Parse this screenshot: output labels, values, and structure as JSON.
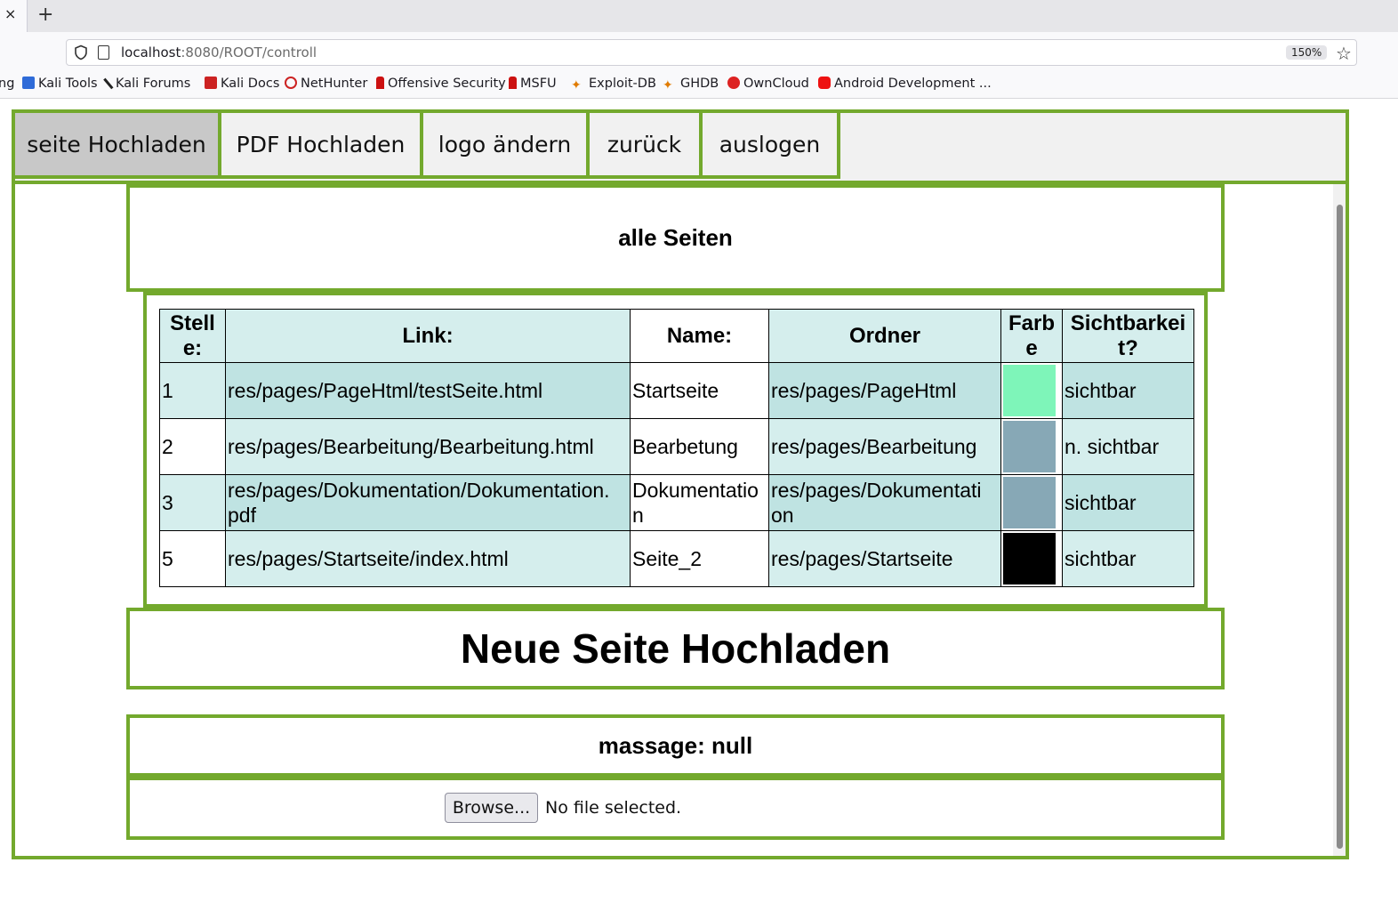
{
  "browser": {
    "tab_close": "×",
    "new_tab": "+",
    "url_host": "localhost",
    "url_path": ":8080/ROOT/controll",
    "zoom": "150%",
    "bookmark_partial": "ng",
    "bookmarks": [
      {
        "label": "Kali Tools",
        "icon_color": "#2f6bd8"
      },
      {
        "label": "Kali Forums",
        "icon_color": "#222222"
      },
      {
        "label": "Kali Docs",
        "icon_color": "#cc2222"
      },
      {
        "label": "NetHunter",
        "icon_color": "#cc2222"
      },
      {
        "label": "Offensive Security",
        "icon_color": "#cc1111"
      },
      {
        "label": "MSFU",
        "icon_color": "#cc1111"
      },
      {
        "label": "Exploit-DB",
        "icon_color": "#e07b00"
      },
      {
        "label": "GHDB",
        "icon_color": "#e07b00"
      },
      {
        "label": "OwnCloud",
        "icon_color": "#dd2222"
      },
      {
        "label": "Android Development ...",
        "icon_color": "#ee1111"
      }
    ]
  },
  "menu": {
    "items": [
      "seite Hochladen",
      "PDF Hochladen",
      "logo ändern",
      "zurück",
      "auslogen"
    ],
    "active_index": 0
  },
  "section_title": "alle Seiten",
  "table": {
    "headers": [
      "Stelle:",
      "Link:",
      "Name:",
      "Ordner",
      "Farbe",
      "Sichtbarkeit?"
    ],
    "rows": [
      {
        "stelle": "1",
        "link": "res/pages/PageHtml/testSeite.html",
        "name": "Startseite",
        "ordner": "res/pages/PageHtml",
        "farbe": "#7ef5b9",
        "sichtbarkeit": "sichtbar"
      },
      {
        "stelle": "2",
        "link": "res/pages/Bearbeitung/Bearbeitung.html",
        "name": "Bearbetung",
        "ordner": "res/pages/Bearbeitung",
        "farbe": "#87a8b6",
        "sichtbarkeit": "n. sichtbar"
      },
      {
        "stelle": "3",
        "link": "res/pages/Dokumentation/Dokumentation.pdf",
        "name": "Dokumentation",
        "ordner": "res/pages/Dokumentation",
        "farbe": "#87a8b6",
        "sichtbarkeit": "sichtbar"
      },
      {
        "stelle": "5",
        "link": "res/pages/Startseite/index.html",
        "name": "Seite_2",
        "ordner": "res/pages/Startseite",
        "farbe": "#000000",
        "sichtbarkeit": "sichtbar"
      }
    ]
  },
  "upload": {
    "heading": "Neue Seite Hochladen",
    "message": "massage: null",
    "browse_label": "Browse...",
    "file_status": "No file selected."
  },
  "colors": {
    "accent_border": "#73a92d",
    "menu_bg": "#f1f1f1",
    "menu_active_bg": "#c8c8c8"
  }
}
